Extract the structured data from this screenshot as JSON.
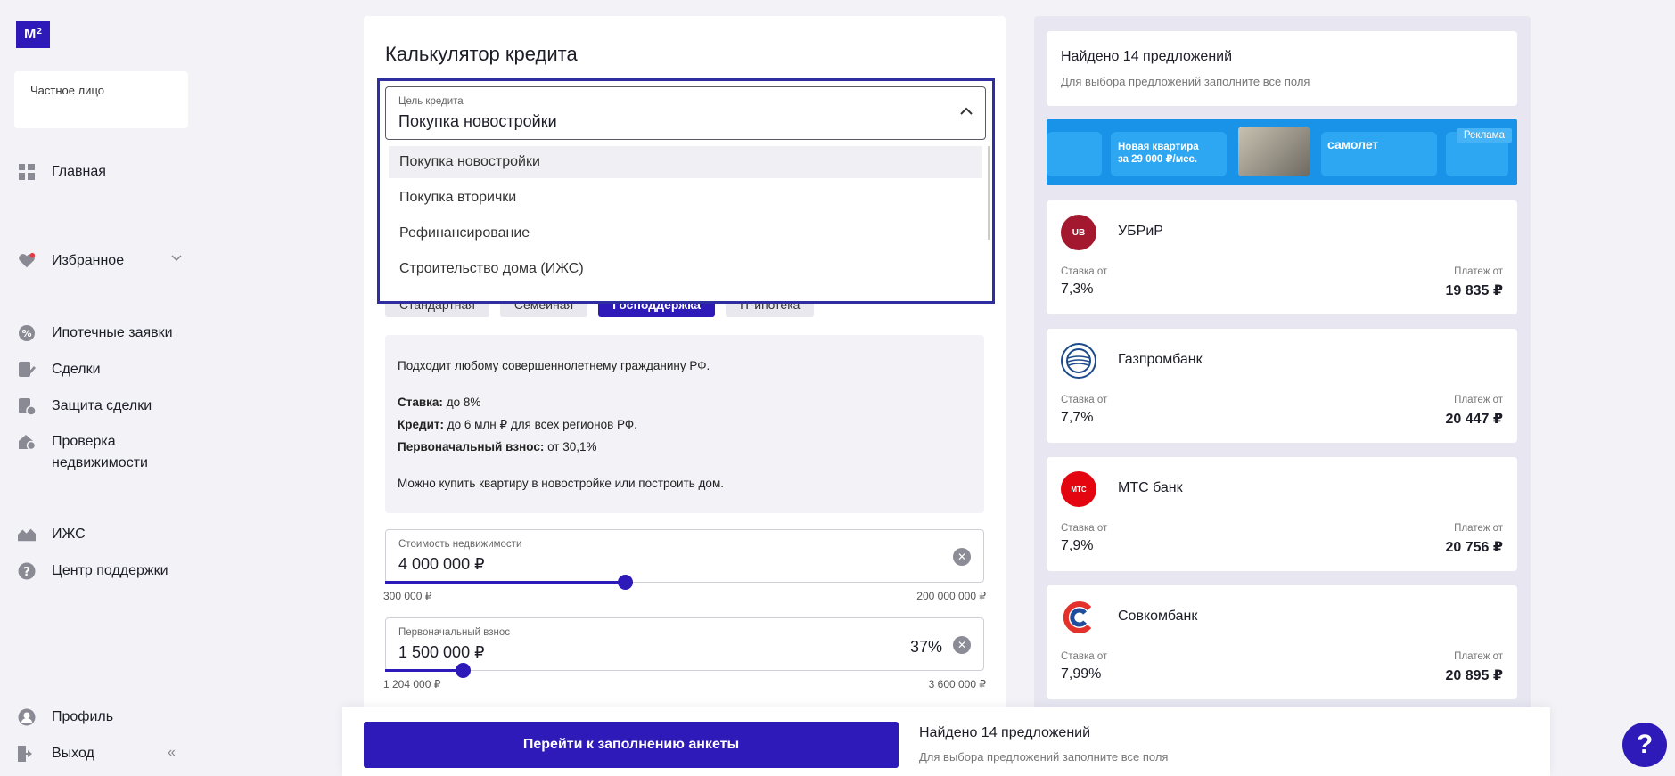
{
  "sidebar": {
    "logo": {
      "main": "M",
      "sup": "2"
    },
    "account_type": "Частное лицо",
    "nav": {
      "home": "Главная",
      "favorites": "Избранное",
      "mortgage_requests": "Ипотечные заявки",
      "deals": "Сделки",
      "deal_protection": "Защита сделки",
      "property_check_line1": "Проверка",
      "property_check_line2": "недвижимости",
      "izhs": "ИЖС",
      "support": "Центр поддержки",
      "profile": "Профиль",
      "logout": "Выход"
    },
    "collapse_glyph": "«"
  },
  "calculator": {
    "title": "Калькулятор кредита",
    "purpose": {
      "label": "Цель кредита",
      "value": "Покупка новостройки",
      "options": [
        "Покупка новостройки",
        "Покупка вторички",
        "Рефинансирование",
        "Строительство дома (ИЖС)"
      ]
    },
    "tabs": [
      "Стандартная",
      "Семейная",
      "Господдержка",
      "IT-ипотека"
    ],
    "active_tab_index": 2,
    "info": {
      "intro": "Подходит любому совершеннолетнему гражданину РФ.",
      "rate_label": "Ставка:",
      "rate_value": " до 8%",
      "credit_label": "Кредит:",
      "credit_value": " до 6 млн ₽ для всех регионов РФ.",
      "down_label": "Первоначальный взнос:",
      "down_value": " от 30,1%",
      "note": "Можно купить квартиру в новостройке или построить дом."
    },
    "price": {
      "label": "Стоимость недвижимости",
      "value": "4 000 000 ₽",
      "min": "300 000 ₽",
      "max": "200 000 000 ₽",
      "slider_fraction": 0.4
    },
    "down_payment": {
      "label": "Первоначальный взнос",
      "value": "1 500 000 ₽",
      "percent": "37%",
      "min": "1 204 000 ₽",
      "max": "3 600 000 ₽",
      "slider_fraction": 0.13
    }
  },
  "offers": {
    "found_title": "Найдено 14 предложений",
    "found_subtitle": "Для выбора предложений заполните все поля",
    "banner": {
      "promo_line1": "Новая квартира",
      "promo_line2": "за 29 000 ₽/мес.",
      "brand": "самолет",
      "ad_label": "Реклама"
    },
    "rate_label": "Ставка от",
    "payment_label": "Платеж от",
    "banks": [
      {
        "name": "УБРиР",
        "rate": "7,3%",
        "payment": "19 835 ₽",
        "logo_color": "#a3182f",
        "logo_text": "UB"
      },
      {
        "name": "Газпромбанк",
        "rate": "7,7%",
        "payment": "20 447 ₽",
        "logo_color": "#ffffff",
        "logo_text": ""
      },
      {
        "name": "МТС банк",
        "rate": "7,9%",
        "payment": "20 756 ₽",
        "logo_color": "#e30611",
        "logo_text": "МТС"
      },
      {
        "name": "Совкомбанк",
        "rate": "7,99%",
        "payment": "20 895 ₽",
        "logo_color": "#ffffff",
        "logo_text": ""
      }
    ]
  },
  "bottom_bar": {
    "cta": "Перейти к заполнению анкеты",
    "title": "Найдено 14 предложений",
    "subtitle": "Для выбора предложений заполните все поля"
  },
  "help_glyph": "?",
  "colors": {
    "accent": "#2e1ab8",
    "focus_border": "#2e2ea0",
    "banner_blue": "#1893e8"
  }
}
